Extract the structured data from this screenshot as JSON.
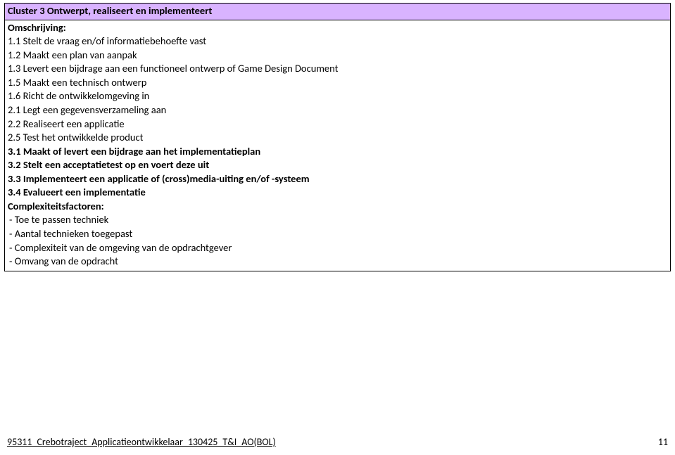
{
  "header": "Cluster 3 Ontwerpt, realiseert en implementeert",
  "labels": {
    "omschrijving": "Omschrijving:",
    "complexiteit": "Complexiteitsfactoren:"
  },
  "items": [
    "1.1 Stelt de vraag en/of informatiebehoefte vast",
    "1.2 Maakt een plan van aanpak",
    "1.3 Levert een bijdrage aan een functioneel ontwerp of Game Design Document",
    "1.5 Maakt een technisch ontwerp",
    "1.6 Richt de ontwikkelomgeving in",
    "2.1 Legt een gegevensverzameling aan",
    "2.2 Realiseert een applicatie",
    "2.5 Test het ontwikkelde product"
  ],
  "bolditems": [
    "3.1 Maakt of levert een bijdrage aan het implementatieplan",
    "3.2 Stelt een acceptatietest op en voert deze uit",
    "3.3 Implementeert een applicatie of (cross)media-uiting en/of -systeem",
    "3.4 Evalueert een implementatie"
  ],
  "complex": [
    "- Toe te passen techniek",
    "- Aantal technieken toegepast",
    "- Complexiteit van de omgeving van de opdrachtgever",
    "- Omvang van de opdracht"
  ],
  "footer": {
    "left": "95311_Crebotraject_Applicatieontwikkelaar_130425_T&I_AO(BOL)",
    "right": "11"
  }
}
